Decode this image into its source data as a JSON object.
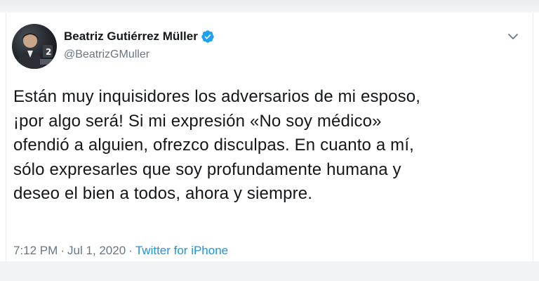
{
  "author": {
    "display_name": "Beatriz Gutiérrez Müller",
    "handle": "@BeatrizGMuller",
    "verified": true,
    "avatar_icon": "profile-photo"
  },
  "tweet": {
    "text": "Están muy inquisidores los adversarios de mi esposo,\n¡por algo será! Si mi expresión «No soy médico»\nofendió a alguien, ofrezco disculpas. En cuanto a mí,\nsólo expresarles que soy profundamente humana y\ndeseo el bien a todos, ahora y siempre.",
    "time": "7:12 PM",
    "date": "Jul 1, 2020",
    "source": "Twitter for iPhone",
    "separator": "·"
  },
  "icons": {
    "verified": "verified-badge-icon",
    "menu": "chevron-down-icon"
  },
  "colors": {
    "text_primary": "#14171a",
    "text_secondary": "#657786",
    "link": "#1b95e0",
    "verified_badge": "#1da1f2"
  }
}
